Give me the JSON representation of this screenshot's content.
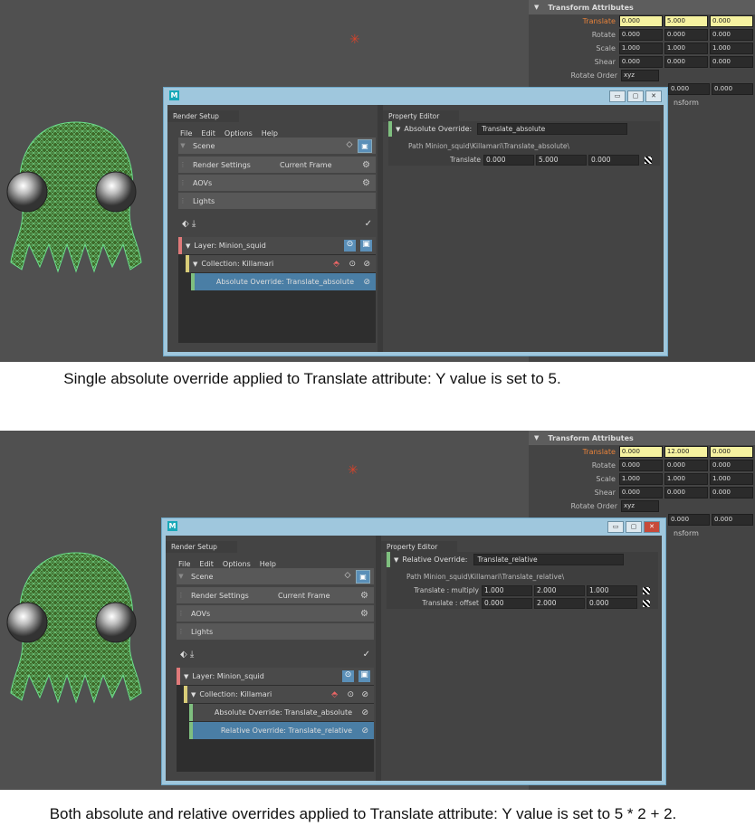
{
  "panel1": {
    "attribute_editor": {
      "section_title": "Transform Attributes",
      "rows": [
        {
          "label": "Translate",
          "values": [
            "0.000",
            "5.000",
            "0.000"
          ]
        },
        {
          "label": "Rotate",
          "values": [
            "0.000",
            "0.000",
            "0.000"
          ]
        },
        {
          "label": "Scale",
          "values": [
            "1.000",
            "1.000",
            "1.000"
          ]
        },
        {
          "label": "Shear",
          "values": [
            "0.000",
            "0.000",
            "0.000"
          ]
        }
      ],
      "rotate_order_label": "Rotate Order",
      "rotate_order_value": "xyz",
      "hidden_row_values": [
        "0.000",
        "0.000"
      ],
      "partial_label": "nsform"
    },
    "window": {
      "render_setup_tab": "Render Setup",
      "property_editor_tab": "Property Editor",
      "menu": [
        "File",
        "Edit",
        "Options",
        "Help"
      ],
      "scene": "Scene",
      "render_settings": "Render Settings",
      "current_frame": "Current Frame",
      "aovs": "AOVs",
      "lights": "Lights",
      "layer": "Layer:  Minion_squid",
      "collection": "Collection:  Killamari",
      "overrides": [
        {
          "label": "Absolute Override:  Translate_absolute",
          "selected": true
        }
      ],
      "pe_type": "Absolute Override:",
      "pe_name": "Translate_absolute",
      "pe_path": "Path  Minion_squid\\Killamari\\Translate_absolute\\",
      "pe_rows": [
        {
          "label": "Translate",
          "values": [
            "0.000",
            "5.000",
            "0.000"
          ]
        }
      ]
    },
    "caption": "Single absolute override applied to Translate attribute: Y value is set to 5."
  },
  "panel2": {
    "attribute_editor": {
      "section_title": "Transform Attributes",
      "rows": [
        {
          "label": "Translate",
          "values": [
            "0.000",
            "12.000",
            "0.000"
          ]
        },
        {
          "label": "Rotate",
          "values": [
            "0.000",
            "0.000",
            "0.000"
          ]
        },
        {
          "label": "Scale",
          "values": [
            "1.000",
            "1.000",
            "1.000"
          ]
        },
        {
          "label": "Shear",
          "values": [
            "0.000",
            "0.000",
            "0.000"
          ]
        }
      ],
      "rotate_order_label": "Rotate Order",
      "rotate_order_value": "xyz",
      "hidden_row_values": [
        "0.000",
        "0.000"
      ],
      "partial_label": "nsform"
    },
    "window": {
      "render_setup_tab": "Render Setup",
      "property_editor_tab": "Property Editor",
      "menu": [
        "File",
        "Edit",
        "Options",
        "Help"
      ],
      "scene": "Scene",
      "render_settings": "Render Settings",
      "current_frame": "Current Frame",
      "aovs": "AOVs",
      "lights": "Lights",
      "layer": "Layer:  Minion_squid",
      "collection": "Collection:  Killamari",
      "overrides": [
        {
          "label": "Absolute Override:  Translate_absolute",
          "selected": false
        },
        {
          "label": "Relative Override:  Translate_relative",
          "selected": true
        }
      ],
      "pe_type": "Relative Override:",
      "pe_name": "Translate_relative",
      "pe_path": "Path  Minion_squid\\Killamari\\Translate_relative\\",
      "pe_rows": [
        {
          "label": "Translate : multiply",
          "values": [
            "1.000",
            "2.000",
            "1.000"
          ]
        },
        {
          "label": "Translate : offset",
          "values": [
            "0.000",
            "2.000",
            "0.000"
          ]
        }
      ]
    },
    "caption": "Both absolute and relative overrides applied to Translate attribute:  Y value is set to 5 * 2 + 2."
  },
  "icons": {
    "maya_logo": "M",
    "expand": "▼",
    "gear": "⚙",
    "eye": "◇",
    "visible": "▣",
    "disable": "⊘",
    "isolate": "⊙",
    "pin": "⬘"
  }
}
